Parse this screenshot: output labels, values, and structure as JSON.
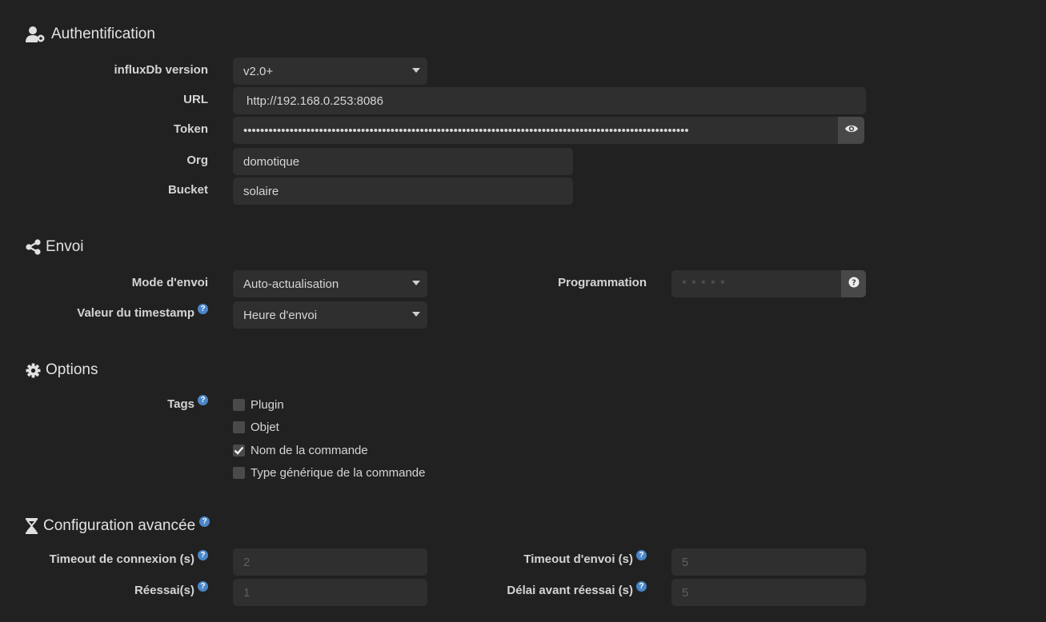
{
  "authentification": {
    "title": "Authentification",
    "influx_version_label": "influxDb version",
    "influx_version_value": "v2.0+",
    "url_label": "URL",
    "url_value": "http://192.168.0.253:8086",
    "token_label": "Token",
    "token_value": "••••••••••••••••••••••••••••••••••••••••••••••••••••••••••••••••••••••••••••••••••••••••••••••••••••••••••",
    "org_label": "Org",
    "org_value": "domotique",
    "bucket_label": "Bucket",
    "bucket_value": "solaire"
  },
  "envoi": {
    "title": "Envoi",
    "mode_label": "Mode d'envoi",
    "mode_value": "Auto-actualisation",
    "timestamp_label": "Valeur du timestamp",
    "timestamp_value": "Heure d'envoi",
    "programmation_label": "Programmation",
    "programmation_placeholder": "* * * * *"
  },
  "options": {
    "title": "Options",
    "tags_label": "Tags",
    "tags": [
      {
        "label": "Plugin",
        "checked": false
      },
      {
        "label": "Objet",
        "checked": false
      },
      {
        "label": "Nom de la commande",
        "checked": true
      },
      {
        "label": "Type générique de la commande",
        "checked": false
      }
    ]
  },
  "avancee": {
    "title": "Configuration avancée",
    "timeout_connexion_label": "Timeout de connexion (s)",
    "timeout_connexion_placeholder": "2",
    "timeout_envoi_label": "Timeout d'envoi (s)",
    "timeout_envoi_placeholder": "5",
    "reessai_label": "Réessai(s)",
    "reessai_placeholder": "1",
    "delai_label": "Délai avant réessai (s)",
    "delai_placeholder": "5"
  },
  "help_glyph": "?",
  "colors": {
    "background": "#212121",
    "field": "#2f2f2f",
    "help": "#4a86c8"
  }
}
